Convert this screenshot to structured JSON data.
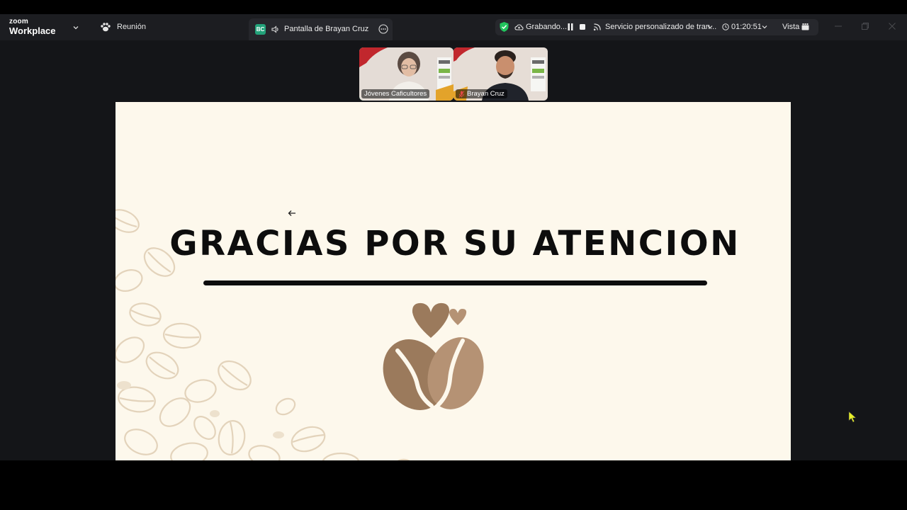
{
  "app": {
    "brand_top": "zoom",
    "brand_bottom": "Workplace"
  },
  "meeting": {
    "label": "Reunión"
  },
  "share_tab": {
    "initials": "BC",
    "label": "Pantalla de Brayan Cruz"
  },
  "status": {
    "recording_label": "Grabando...",
    "service_label": "Servicio personalizado de tran...",
    "timer": "01:20:51",
    "view_label": "Vista",
    "shield_color": "#21c45d"
  },
  "participants": [
    {
      "name": "Jóvenes Caficultores",
      "active": true,
      "muted": false
    },
    {
      "name": "Brayan Cruz",
      "active": false,
      "muted": true
    }
  ],
  "slide": {
    "title": "GRACIAS POR SU ATENCION",
    "background_color": "#fdf8ec",
    "logo_colors": [
      "#9b7a5c",
      "#b59274"
    ]
  },
  "icons": [
    "chevron-down-icon",
    "paw-icon",
    "speaker-icon",
    "more-icon",
    "shield-check-icon",
    "cloud-icon",
    "pause-icon",
    "stop-icon",
    "feed-icon",
    "clock-icon",
    "view-grid-icon",
    "minimize-icon",
    "restore-icon",
    "close-icon",
    "mic-muted-icon",
    "arrow-left-icon",
    "cursor-icon"
  ]
}
